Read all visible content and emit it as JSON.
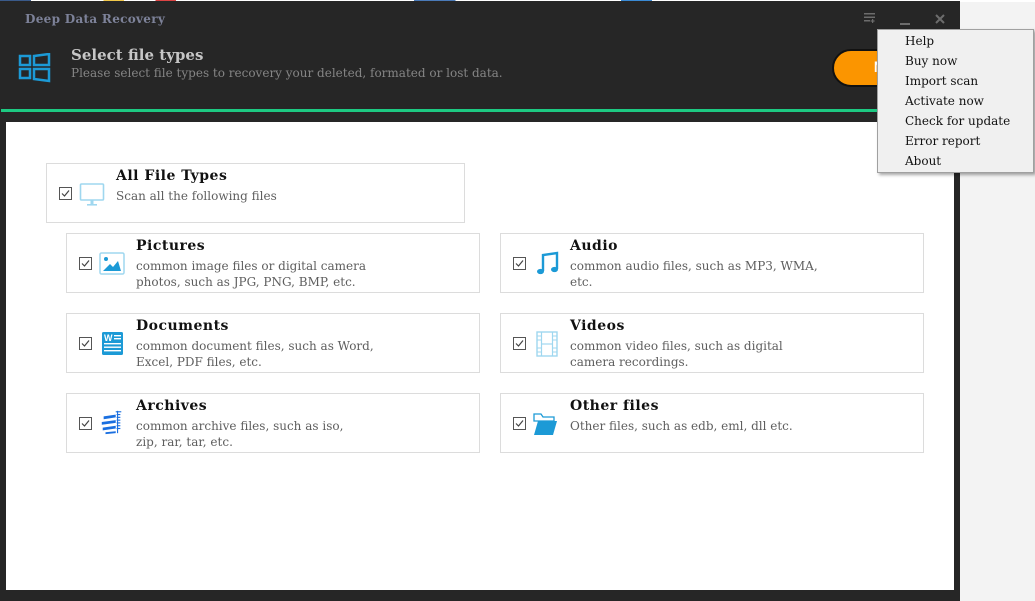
{
  "window": {
    "title": "Deep Data Recovery",
    "controls": {
      "menu_icon": "menu-list-icon",
      "minimize_icon": "minimize-icon",
      "close_icon": "close-icon"
    }
  },
  "header": {
    "icon": "windows-grid-icon",
    "title": "Select file types",
    "subtitle": "Please select file types to recovery your deleted, formated or lost data.",
    "next_button_label": "N"
  },
  "colors": {
    "accent_green": "#1dc982",
    "button_orange": "#fb9500",
    "icon_blue": "#1c9ad6",
    "frame_dark": "#262626"
  },
  "file_types": {
    "all": {
      "title": "All File Types",
      "description": "Scan all the following files",
      "checked": true,
      "icon": "monitor-icon"
    },
    "items": [
      {
        "title": "Pictures",
        "description": "common image files or digital camera\nphotos, such as JPG, PNG, BMP, etc.",
        "checked": true,
        "icon": "picture-icon"
      },
      {
        "title": "Audio",
        "description": "common audio files, such as MP3, WMA,\netc.",
        "checked": true,
        "icon": "music-note-icon"
      },
      {
        "title": "Documents",
        "description": "common document files, such as Word,\nExcel, PDF files, etc.",
        "checked": true,
        "icon": "word-document-icon"
      },
      {
        "title": "Videos",
        "description": "common video files, such as digital\ncamera recordings.",
        "checked": true,
        "icon": "film-strip-icon"
      },
      {
        "title": "Archives",
        "description": "common archive files, such as iso,\nzip, rar, tar, etc.",
        "checked": true,
        "icon": "archive-zip-icon"
      },
      {
        "title": "Other files",
        "description": "Other files, such as edb, eml, dll etc.",
        "checked": true,
        "icon": "folder-icon"
      }
    ]
  },
  "context_menu": {
    "items": [
      "Help",
      "Buy now",
      "Import scan",
      "Activate now",
      "Check for update",
      "Error report",
      "About"
    ]
  }
}
